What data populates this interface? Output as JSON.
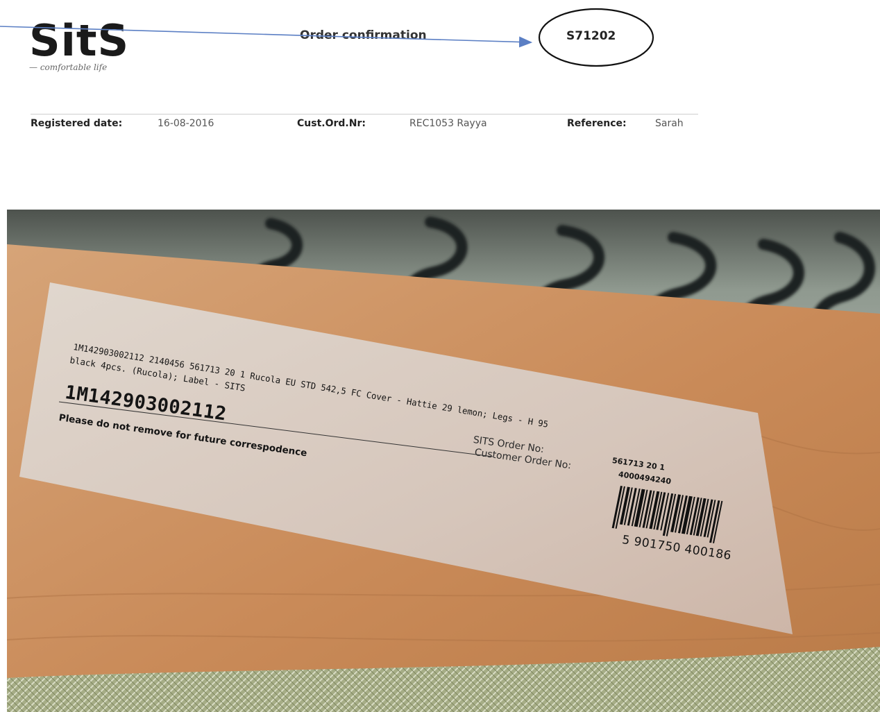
{
  "header": {
    "logo_text": "SitS",
    "logo_tagline": "— comfortable life",
    "document_title": "Order confirmation",
    "order_number": "S71202"
  },
  "meta": {
    "registered_date_label": "Registered date:",
    "registered_date_value": "16-08-2016",
    "cust_ord_label": "Cust.Ord.Nr:",
    "cust_ord_value": "REC1053 Rayya",
    "reference_label": "Reference:",
    "reference_value": "Sarah"
  },
  "photo_label": {
    "line1": "1M142903002112  2140456 561713 20 1 Rucola EU STD 542,5 FC Cover - Hattie 29 lemon; Legs - H 95",
    "line2": "black 4pcs. (Rucola); Label - SITS",
    "big_code": "1M142903002112",
    "note": "Please do not remove for future correspodence",
    "sits_order_label": "SITS Order No:",
    "sits_order_value": "561713 20 1",
    "customer_order_label": "Customer Order No:",
    "customer_order_value": "4000494240",
    "ean_digits": "5  901750  400186"
  },
  "colors": {
    "annotation_blue": "#5b7fc4",
    "wood": "#c98d5c",
    "fabric": "#9aa59a",
    "label_paper": "#d9cdc2"
  }
}
